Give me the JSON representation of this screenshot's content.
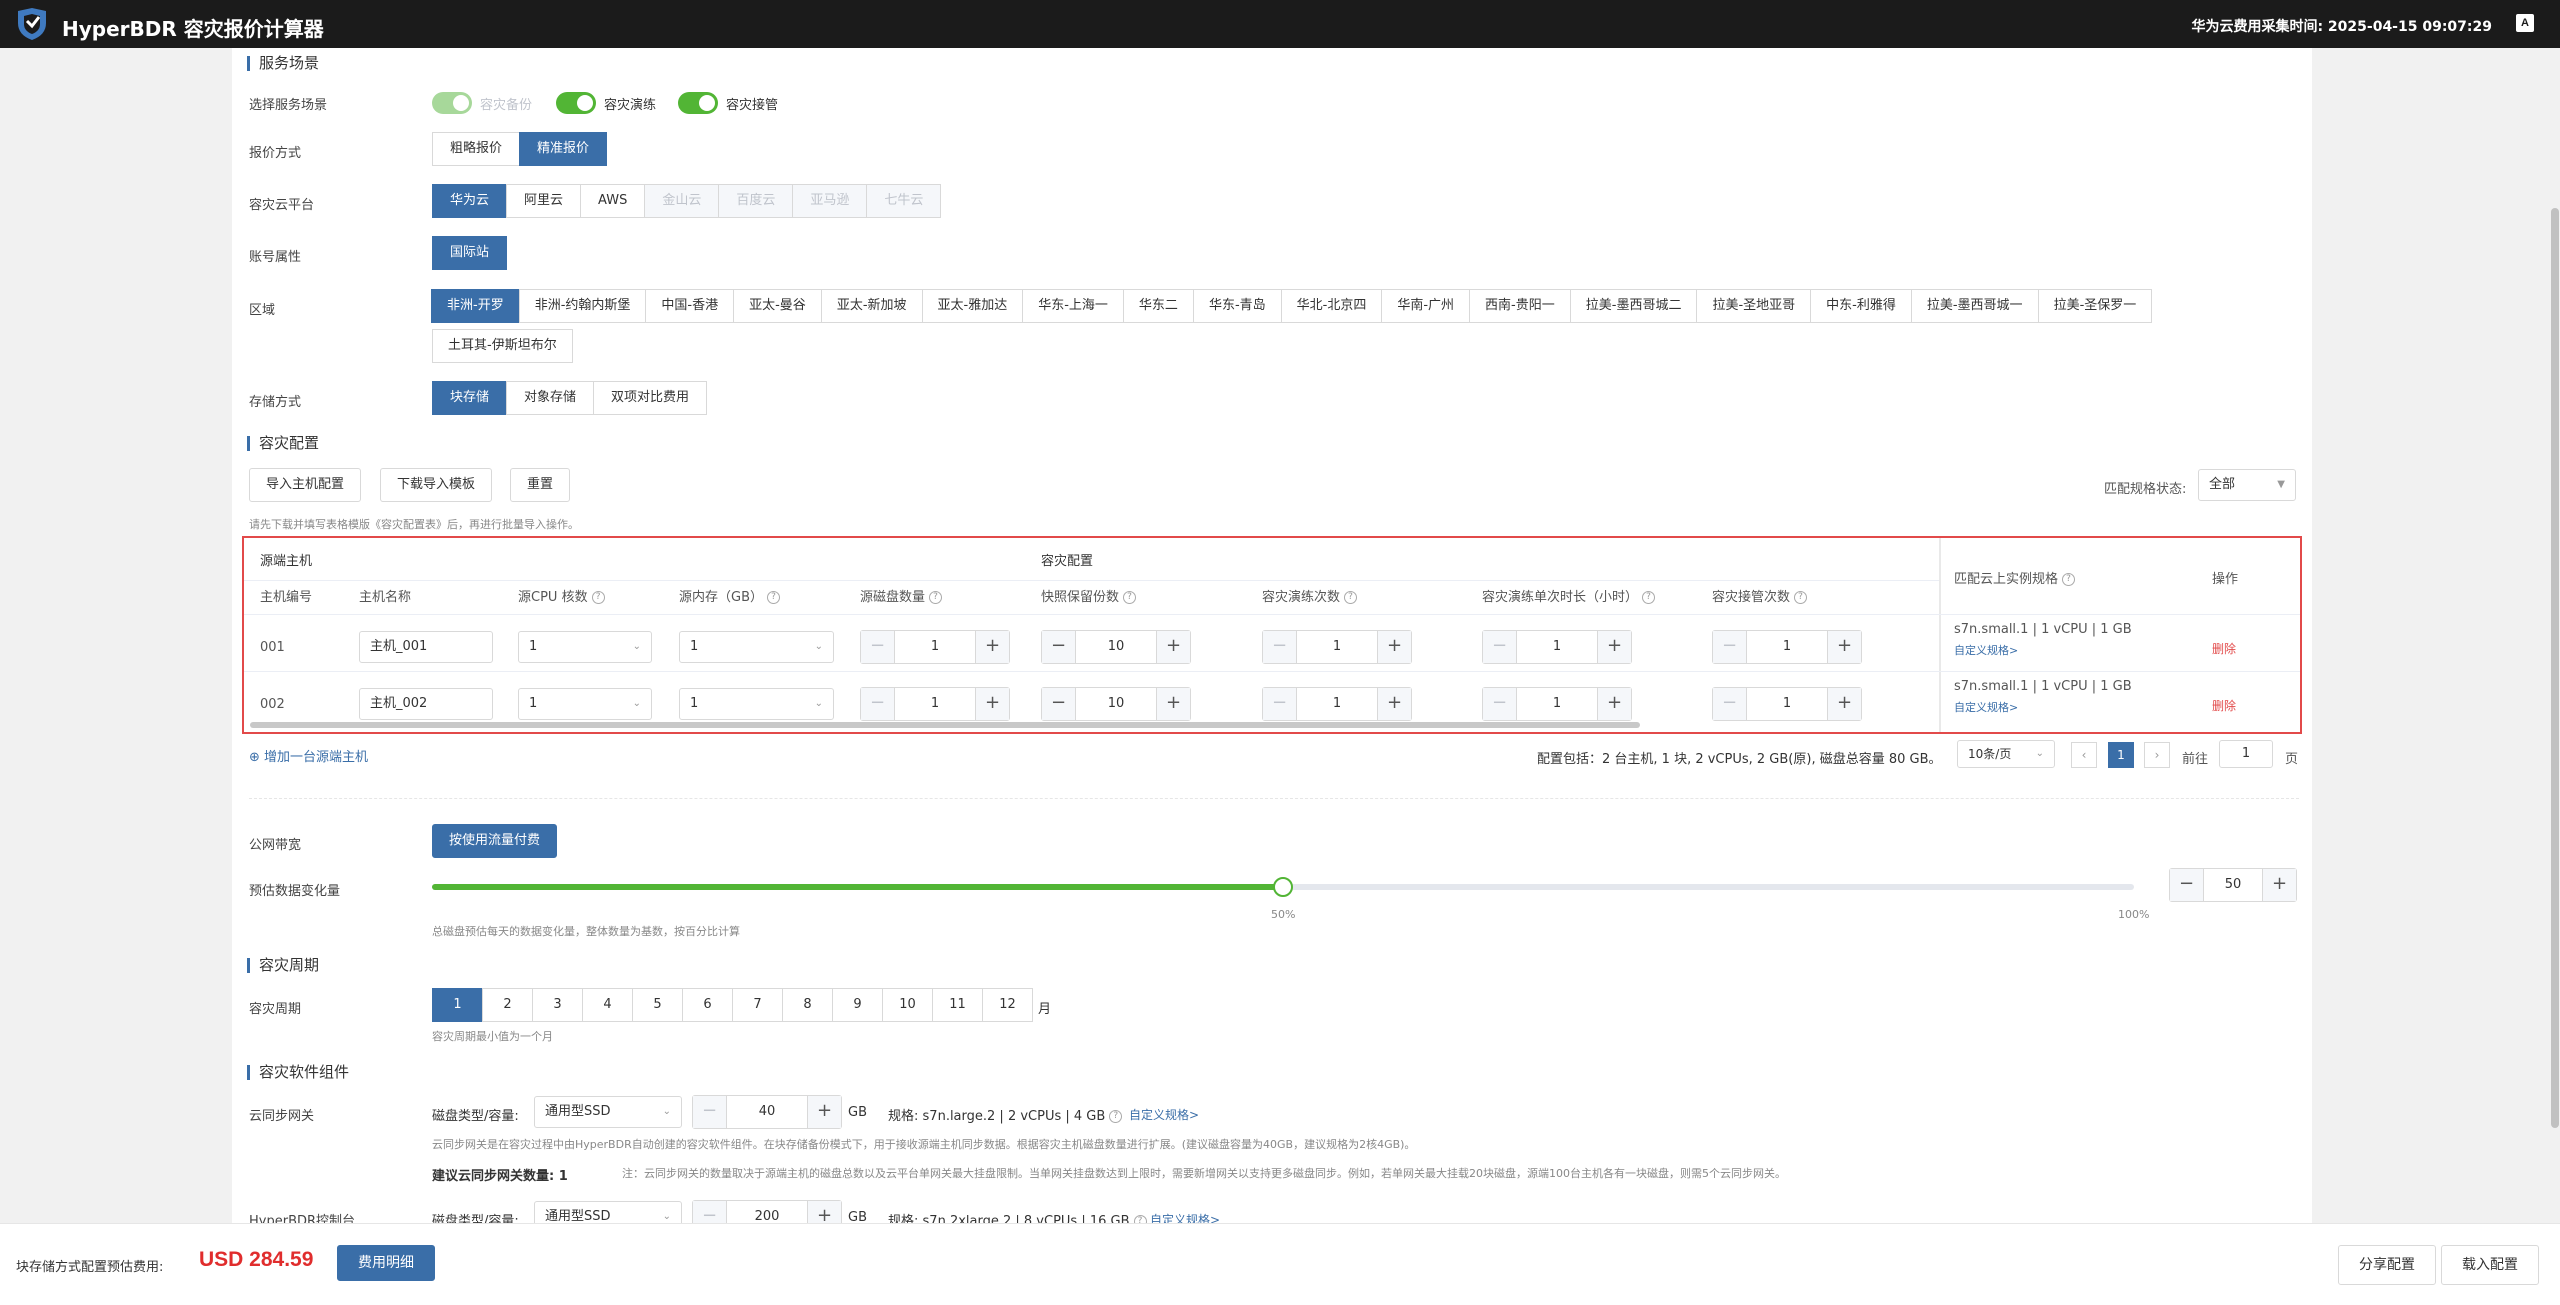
{
  "app": {
    "title": "HyperBDR 容灾报价计算器",
    "collect_time": "华为云费用采集时间: 2025-04-15 09:07:29",
    "lang": "A"
  },
  "service": {
    "section_title": "服务场景",
    "scene_label": "选择服务场景",
    "toggles": [
      {
        "label": "容灾备份",
        "on": true,
        "disabled": true
      },
      {
        "label": "容灾演练",
        "on": true,
        "disabled": false
      },
      {
        "label": "容灾接管",
        "on": true,
        "disabled": false
      }
    ],
    "quote_label": "报价方式",
    "quote_options": [
      {
        "label": "粗略报价",
        "on": false
      },
      {
        "label": "精准报价",
        "on": true
      }
    ],
    "cloud_label": "容灾云平台",
    "cloud_options": [
      {
        "label": "华为云",
        "on": true,
        "dis": false
      },
      {
        "label": "阿里云",
        "on": false,
        "dis": false
      },
      {
        "label": "AWS",
        "on": false,
        "dis": false
      },
      {
        "label": "金山云",
        "on": false,
        "dis": true
      },
      {
        "label": "百度云",
        "on": false,
        "dis": true
      },
      {
        "label": "亚马逊",
        "on": false,
        "dis": true
      },
      {
        "label": "七牛云",
        "on": false,
        "dis": true
      }
    ],
    "account_label": "账号属性",
    "account_options": [
      {
        "label": "国际站",
        "on": true
      }
    ],
    "region_label": "区域",
    "regions": [
      {
        "label": "非洲-开罗",
        "on": true
      },
      {
        "label": "非洲-约翰内斯堡",
        "on": false
      },
      {
        "label": "中国-香港",
        "on": false
      },
      {
        "label": "亚太-曼谷",
        "on": false
      },
      {
        "label": "亚太-新加坡",
        "on": false
      },
      {
        "label": "亚太-雅加达",
        "on": false
      },
      {
        "label": "华东-上海一",
        "on": false
      },
      {
        "label": "华东二",
        "on": false
      },
      {
        "label": "华东-青岛",
        "on": false
      },
      {
        "label": "华北-北京四",
        "on": false
      },
      {
        "label": "华南-广州",
        "on": false
      },
      {
        "label": "西南-贵阳一",
        "on": false
      },
      {
        "label": "拉美-墨西哥城二",
        "on": false
      },
      {
        "label": "拉美-圣地亚哥",
        "on": false
      },
      {
        "label": "中东-利雅得",
        "on": false
      },
      {
        "label": "拉美-墨西哥城一",
        "on": false
      },
      {
        "label": "拉美-圣保罗一",
        "on": false
      },
      {
        "label": "土耳其-伊斯坦布尔",
        "on": false
      }
    ],
    "storage_label": "存储方式",
    "storage_options": [
      {
        "label": "块存储",
        "on": true
      },
      {
        "label": "对象存储",
        "on": false
      },
      {
        "label": "双项对比费用",
        "on": false
      }
    ]
  },
  "dr_config": {
    "section_title": "容灾配置",
    "import_btn": "导入主机配置",
    "download_btn": "下载导入模板",
    "reset_btn": "重置",
    "hint": "请先下载并填写表格模版《容灾配置表》后，再进行批量导入操作。",
    "match_label": "匹配规格状态:",
    "match_value": "全部",
    "group_source": "源端主机",
    "group_dr": "容灾配置",
    "columns": [
      "主机编号",
      "主机名称",
      "源CPU 核数",
      "源内存（GB）",
      "源磁盘数量",
      "快照保留份数",
      "容灾演练次数",
      "容灾演练单次时长（小时）",
      "容灾接管次数",
      "匹配云上实例规格",
      "操作"
    ],
    "rows": [
      {
        "id": "001",
        "name": "主机_001",
        "cpu": "1",
        "mem": "1",
        "disks": "1",
        "snapshots": "10",
        "drills": "1",
        "duration": "1",
        "takeovers": "1",
        "spec": "s7n.small.1 | 1 vCPU | 1 GB",
        "custom": "自定义规格>",
        "op": "删除"
      },
      {
        "id": "002",
        "name": "主机_002",
        "cpu": "1",
        "mem": "1",
        "disks": "1",
        "snapshots": "10",
        "drills": "1",
        "duration": "1",
        "takeovers": "1",
        "spec": "s7n.small.1 | 1 vCPU | 1 GB",
        "custom": "自定义规格>",
        "op": "删除"
      }
    ],
    "add_host": "增加一台源端主机",
    "summary": "配置包括：2 台主机, 1 块, 2 vCPUs, 2 GB(原), 磁盘总容量 80 GB。",
    "page_size": "10条/页",
    "current_page": "1",
    "goto_label": "前往",
    "goto_value": "1",
    "page_unit": "页"
  },
  "bandwidth": {
    "label": "公网带宽",
    "btn": "按使用流量付费"
  },
  "change": {
    "label": "预估数据变化量",
    "percent": 50,
    "mark_mid": "50%",
    "mark_max": "100%",
    "value": "50",
    "hint": "总磁盘预估每天的数据变化量，整体数量为基数，按百分比计算"
  },
  "period": {
    "section_title": "容灾周期",
    "label": "容灾周期",
    "months": [
      {
        "label": "1",
        "on": true
      },
      {
        "label": "2",
        "on": false
      },
      {
        "label": "3",
        "on": false
      },
      {
        "label": "4",
        "on": false
      },
      {
        "label": "5",
        "on": false
      },
      {
        "label": "6",
        "on": false
      },
      {
        "label": "7",
        "on": false
      },
      {
        "label": "8",
        "on": false
      },
      {
        "label": "9",
        "on": false
      },
      {
        "label": "10",
        "on": false
      },
      {
        "label": "11",
        "on": false
      },
      {
        "label": "12",
        "on": false
      }
    ],
    "unit": "月",
    "hint": "容灾周期最小值为一个月"
  },
  "components": {
    "section_title": "容灾软件组件",
    "gateway": {
      "label": "云同步网关",
      "disk_label": "磁盘类型/容量:",
      "disk_type": "通用型SSD",
      "capacity": "40",
      "unit": "GB",
      "spec_label": "规格:",
      "spec": "s7n.large.2 | 2 vCPUs | 4 GB",
      "custom": "自定义规格>",
      "hint": "云同步网关是在容灾过程中由HyperBDR自动创建的容灾软件组件。在块存储备份模式下，用于接收源端主机同步数据。根据容灾主机磁盘数量进行扩展。(建议磁盘容量为40GB，建议规格为2核4GB)。",
      "suggest": "建议云同步网关数量: 1",
      "note": "注：云同步网关的数量取决于源端主机的磁盘总数以及云平台单网关最大挂盘限制。当单网关挂盘数达到上限时，需要新增网关以支持更多磁盘同步。例如，若单网关最大挂载20块磁盘，源端100台主机各有一块磁盘，则需5个云同步网关。"
    },
    "controller": {
      "label": "HyperBDR控制台",
      "disk_label": "磁盘类型/容量:",
      "disk_type": "通用型SSD",
      "capacity": "200",
      "unit": "GB",
      "spec_label": "规格:",
      "spec": "s7n.2xlarge.2 | 8 vCPUs | 16 GB",
      "custom": "自定义规格>"
    }
  },
  "footer": {
    "label": "块存储方式配置预估费用:",
    "price": "USD 284.59",
    "detail_btn": "费用明细",
    "share_btn": "分享配置",
    "load_btn": "载入配置"
  },
  "colors": {
    "primary": "#3a6ea8",
    "toggle_on": "#52b535",
    "danger": "#e24a4a",
    "price": "#e02d2d"
  }
}
